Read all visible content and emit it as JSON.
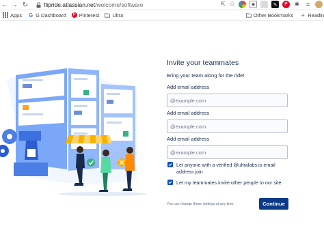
{
  "browser": {
    "url_host": "flipride.atlassian.net",
    "url_path": "/welcome/software",
    "bookmarks": [
      "Apps",
      "G Dashboard",
      "Pinterest",
      "Ultra"
    ],
    "other_bookmarks": "Other Bookmarks",
    "reading_list": "Readin"
  },
  "form": {
    "title": "Invite your teammates",
    "subtitle": "Bring your team along for the ride!",
    "fields": [
      {
        "label": "Add email address",
        "placeholder": "@example.com"
      },
      {
        "label": "Add email address",
        "placeholder": "@example.com"
      },
      {
        "label": "Add email address",
        "placeholder": "@example.com"
      }
    ],
    "checkboxes": [
      {
        "label": "Let anyone with a verified @ultralabs.io email address join",
        "checked": true
      },
      {
        "label": "Let my teammates invite other people to our site",
        "checked": true
      }
    ],
    "note": "You can change these settings at any time.",
    "continue_label": "Continue"
  },
  "colors": {
    "primary_button": "#0c3a8a",
    "checkbox": "#0052cc",
    "text": "#172b4d"
  },
  "icons": {
    "back": "arrow-left-icon",
    "forward": "arrow-right-icon",
    "reload": "reload-icon",
    "lock": "lock-icon"
  }
}
